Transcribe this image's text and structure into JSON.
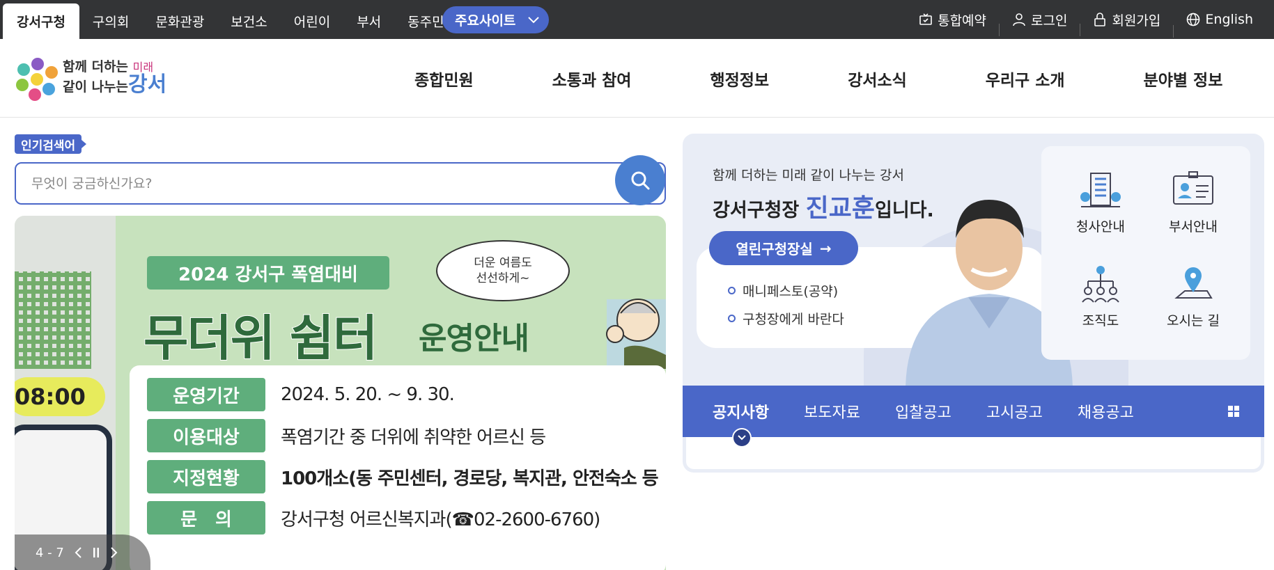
{
  "topbar": {
    "tabs": [
      "강서구청",
      "구의회",
      "문화관광",
      "보건소",
      "어린이",
      "부서",
      "동주민"
    ],
    "main_sites": "주요사이트",
    "links": [
      "통합예약",
      "로그인",
      "회원가입",
      "English"
    ]
  },
  "header": {
    "logo": {
      "line1": "함께 더하는",
      "line1_sub": "미래",
      "line2": "같이 나누는",
      "line2_big": "강서"
    },
    "nav": [
      "종합민원",
      "소통과 참여",
      "행정정보",
      "강서소식",
      "우리구 소개",
      "분야별 정보"
    ]
  },
  "search": {
    "popular_label": "인기검색어",
    "placeholder": "무엇이 궁금하신가요?"
  },
  "banner": {
    "tag": "2024 강서구 폭염대비",
    "title_big": "무더위 쉼터",
    "title_small": "운영안내",
    "bubble_line1": "더운 여름도",
    "bubble_line2": "선선하게~",
    "time_text": "08:00",
    "rows": [
      {
        "label": "운영기간",
        "value": "2024. 5. 20. ~ 9. 30."
      },
      {
        "label": "이용대상",
        "value": "폭염기간 중 더위에 취약한 어르신 등"
      },
      {
        "label": "지정현황",
        "value": "100개소(동 주민센터, 경로당, 복지관, 안전숙소 등"
      },
      {
        "label": "문　의",
        "value": "강서구청 어르신복지과(☎02-2600-6760)"
      }
    ],
    "slider": {
      "counter": "4 - 7"
    }
  },
  "mayor": {
    "slogan": "함께 더하는 미래 같이 나누는 강서",
    "title_prefix": "강서구청장 ",
    "name": "진교훈",
    "title_suffix": "입니다.",
    "open_office": "열린구청장실",
    "links": [
      "매니페스토(공약)",
      "구청장에게 바란다"
    ],
    "quick": [
      "청사안내",
      "부서안내",
      "조직도",
      "오시는 길"
    ]
  },
  "notice": {
    "tabs": [
      "공지사항",
      "보도자료",
      "입찰공고",
      "고시공고",
      "채용공고"
    ]
  },
  "colors": {
    "primary": "#4a67c8",
    "topbar": "#333436",
    "banner_green": "#5fae7c"
  }
}
